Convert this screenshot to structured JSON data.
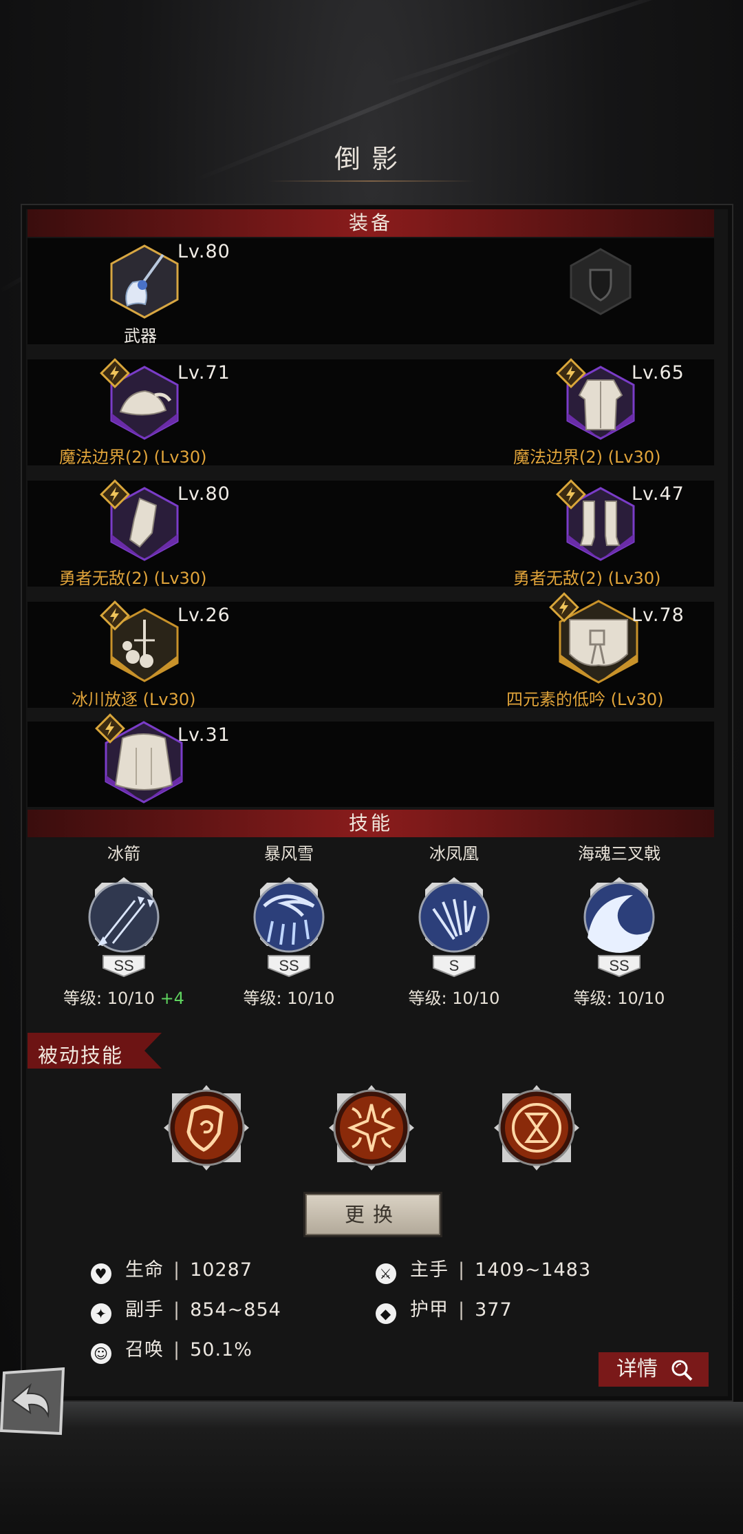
{
  "title": "倒影",
  "equipment": {
    "header": "装备",
    "weapon": {
      "level": "Lv.80",
      "label": "武器"
    },
    "shield_slot_icon": "shield-icon",
    "slots": [
      {
        "level": "Lv.71",
        "set": "魔法边界(2)  (Lv30)",
        "rarity": "purple",
        "icon": "hat-icon"
      },
      {
        "level": "Lv.65",
        "set": "魔法边界(2)  (Lv30)",
        "rarity": "purple",
        "icon": "robe-icon"
      },
      {
        "level": "Lv.80",
        "set": "勇者无敌(2)  (Lv30)",
        "rarity": "purple",
        "icon": "gauntlet-icon"
      },
      {
        "level": "Lv.47",
        "set": "勇者无敌(2)  (Lv30)",
        "rarity": "purple",
        "icon": "boots-icon"
      },
      {
        "level": "Lv.26",
        "set": "冰川放逐  (Lv30)",
        "rarity": "gold",
        "icon": "necklace-icon"
      },
      {
        "level": "Lv.78",
        "set": "四元素的低吟  (Lv30)",
        "rarity": "gold",
        "icon": "belt-icon"
      },
      {
        "level": "Lv.31",
        "set": "",
        "rarity": "purple",
        "icon": "cloak-icon"
      }
    ]
  },
  "skills": {
    "header": "技能",
    "items": [
      {
        "name": "冰箭",
        "grade": "SS",
        "level": "等级: 10/10",
        "bonus": "+4",
        "icon": "ice-arrow-icon"
      },
      {
        "name": "暴风雪",
        "grade": "SS",
        "level": "等级: 10/10",
        "bonus": "",
        "icon": "blizzard-icon"
      },
      {
        "name": "冰凤凰",
        "grade": "S",
        "level": "等级: 10/10",
        "bonus": "",
        "icon": "ice-phoenix-icon"
      },
      {
        "name": "海魂三叉戟",
        "grade": "SS",
        "level": "等级: 10/10",
        "bonus": "",
        "icon": "wave-icon"
      }
    ]
  },
  "passive": {
    "header": "被动技能",
    "icons": [
      "swirl-shield-icon",
      "sun-burst-icon",
      "hourglass-icon"
    ],
    "change_button": "更换"
  },
  "stats": [
    {
      "icon": "heart-icon",
      "label": "生命",
      "value": "10287"
    },
    {
      "icon": "sword-icon",
      "label": "主手",
      "value": "1409~1483"
    },
    {
      "icon": "offhand-icon",
      "label": "副手",
      "value": "854~854"
    },
    {
      "icon": "armor-icon",
      "label": "护甲",
      "value": "377"
    },
    {
      "icon": "summon-icon",
      "label": "召唤",
      "value": "50.1%"
    }
  ],
  "detail_button": "详情",
  "colors": {
    "purple_rarity": "#6a2ca8",
    "gold_rarity": "#c8922a",
    "set_text": "#e1a43a",
    "header_red": "#8a1c1c"
  }
}
